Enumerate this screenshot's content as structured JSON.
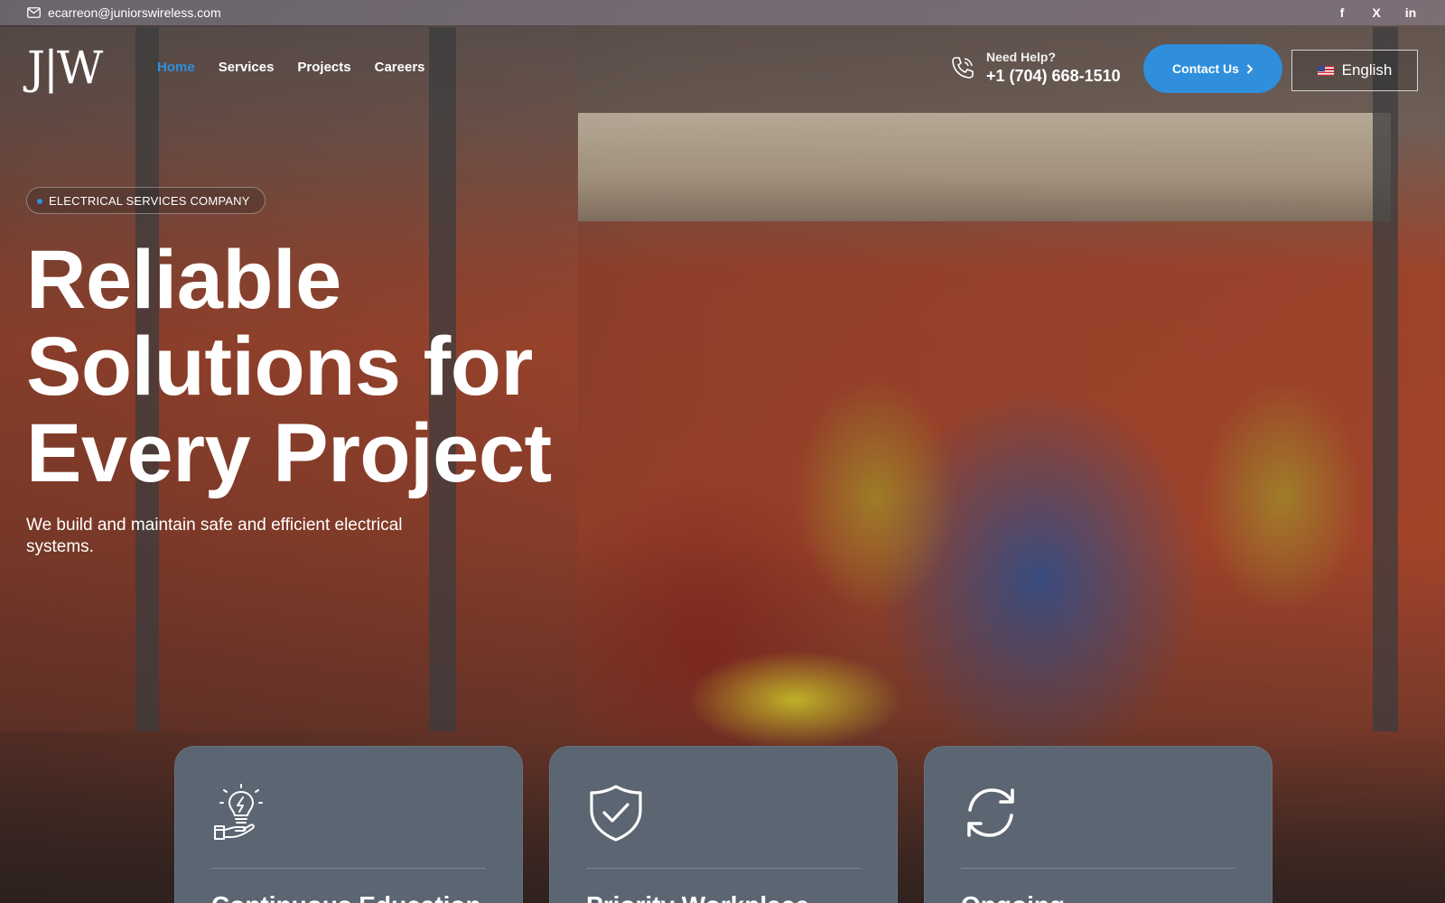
{
  "topbar": {
    "email": "ecarreon@juniorswireless.com",
    "social": [
      {
        "icon": "facebook-icon",
        "glyph": "f"
      },
      {
        "icon": "x-twitter-icon",
        "glyph": "X"
      },
      {
        "icon": "linkedin-icon",
        "glyph": "in"
      }
    ]
  },
  "header": {
    "logo_text": "J|W",
    "nav": [
      {
        "label": "Home",
        "active": true
      },
      {
        "label": "Services",
        "active": false
      },
      {
        "label": "Projects",
        "active": false
      },
      {
        "label": "Careers",
        "active": false
      }
    ],
    "help_label": "Need Help?",
    "phone": "+1 (704) 668-1510",
    "contact_label": "Contact Us",
    "language": "English"
  },
  "hero": {
    "badge": "ELECTRICAL SERVICES COMPANY",
    "headline_lines": [
      "Reliable",
      "Solutions for",
      "Every Project"
    ],
    "subtitle": "We build and maintain safe and efficient electrical systems."
  },
  "cards": [
    {
      "icon": "lightbulb-hand-icon",
      "title": "Continuous Education"
    },
    {
      "icon": "shield-check-icon",
      "title": "Priority Workplace"
    },
    {
      "icon": "refresh-icon",
      "title": "Ongoing"
    }
  ],
  "colors": {
    "accent": "#2f8fdc",
    "card_bg": "#5c6572"
  }
}
